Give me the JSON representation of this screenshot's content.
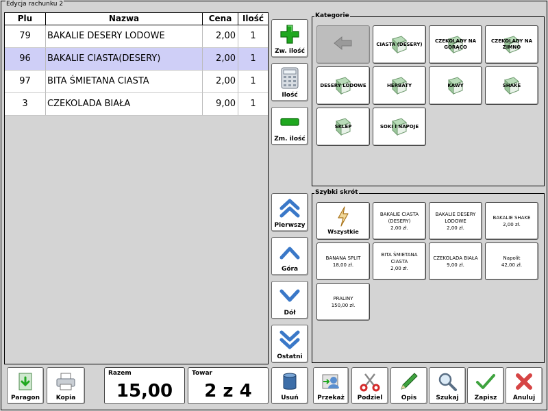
{
  "window": {
    "title": "Edycja rachunku 2"
  },
  "table": {
    "headers": {
      "plu": "Plu",
      "name": "Nazwa",
      "price": "Cena",
      "qty": "Ilość"
    },
    "rows": [
      {
        "plu": "79",
        "name": "BAKALIE DESERY LODOWE",
        "price": "2,00",
        "qty": "1",
        "selected": false
      },
      {
        "plu": "96",
        "name": "BAKALIE CIASTA(DESERY)",
        "price": "2,00",
        "qty": "1",
        "selected": true
      },
      {
        "plu": "97",
        "name": "BITA ŚMIETANA CIASTA",
        "price": "2,00",
        "qty": "1",
        "selected": false
      },
      {
        "plu": "3",
        "name": "CZEKOLADA BIAŁA",
        "price": "9,00",
        "qty": "1",
        "selected": false
      }
    ]
  },
  "side_buttons": {
    "increase": "Zw. ilość",
    "quantity": "Ilość",
    "decrease": "Zm. ilość",
    "first": "Pierwszy",
    "up": "Góra",
    "down": "Dół",
    "last": "Ostatni",
    "delete": "Usuń"
  },
  "categories": {
    "title": "Kategorie",
    "items": [
      {
        "label": "",
        "icon": "back-arrow-icon",
        "disabled": true
      },
      {
        "label": "CIASTA (DESERY)",
        "icon": "book-icon",
        "disabled": false
      },
      {
        "label": "CZEKOLADY NA GORĄCO",
        "icon": "book-icon",
        "disabled": false
      },
      {
        "label": "CZEKOLADY NA ZIMNO",
        "icon": "book-icon",
        "disabled": false
      },
      {
        "label": "DESERY LODOWE",
        "icon": "book-icon",
        "disabled": false
      },
      {
        "label": "HERBATY",
        "icon": "book-icon",
        "disabled": false
      },
      {
        "label": "KAWY",
        "icon": "book-icon",
        "disabled": false
      },
      {
        "label": "SHAKE",
        "icon": "book-icon",
        "disabled": false
      },
      {
        "label": "SKLEP",
        "icon": "book-icon",
        "disabled": false
      },
      {
        "label": "SOKI I NAPOJE",
        "icon": "book-icon",
        "disabled": false
      }
    ]
  },
  "shortcuts": {
    "title": "Szybki skrót",
    "all_label": "Wszystkie",
    "all_icon": "lightning-icon",
    "items": [
      {
        "name": "BAKALIE CIASTA (DESERY)",
        "price": "2,00 zł."
      },
      {
        "name": "BAKALIE DESERY LODOWE",
        "price": "2,00 zł."
      },
      {
        "name": "BAKALIE SHAKE",
        "price": "2,00 zł."
      },
      {
        "name": "BANANA SPLIT",
        "price": "18,00 zł."
      },
      {
        "name": "BITA ŚMIETANA CIASTA",
        "price": "2,00 zł."
      },
      {
        "name": "CZEKOLADA BIAŁA",
        "price": "9,00 zł."
      },
      {
        "name": "Napolit",
        "price": "42,00 zł."
      },
      {
        "name": "PRALINY",
        "price": "150,00 zł."
      }
    ]
  },
  "bottom": {
    "receipt": "Paragon",
    "copy": "Kopia",
    "total_caption": "Razem",
    "total_value": "15,00",
    "item_caption": "Towar",
    "item_value": "2 z 4",
    "transfer": "Przekaż",
    "split": "Podziel",
    "description": "Opis",
    "search": "Szukaj",
    "save": "Zapisz",
    "cancel": "Anuluj"
  },
  "colors": {
    "background": "#d4d4d4",
    "selected_row": "#cfcff7",
    "plus_green": "#1fa81f",
    "arrow_blue": "#3a78c8"
  }
}
